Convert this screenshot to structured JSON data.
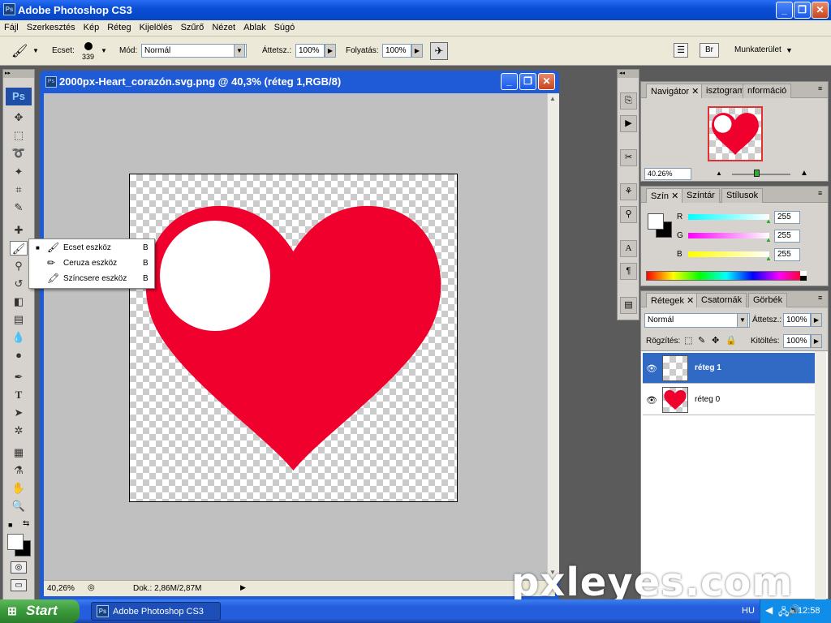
{
  "app": {
    "title": "Adobe Photoshop CS3",
    "icon_text": "Ps"
  },
  "menu": [
    "Fájl",
    "Szerkesztés",
    "Kép",
    "Réteg",
    "Kijelölés",
    "Szűrő",
    "Nézet",
    "Ablak",
    "Súgó"
  ],
  "options": {
    "brush_label": "Ecset:",
    "brush_size": "339",
    "mode_label": "Mód:",
    "mode_value": "Normál",
    "opacity_label": "Áttetsz.:",
    "opacity_value": "100%",
    "flow_label": "Folyatás:",
    "flow_value": "100%",
    "workspace_label": "Munkaterület"
  },
  "document": {
    "title": "2000px-Heart_corazón.svg.png @ 40,3% (réteg 1,RGB/8)",
    "zoom": "40,26%",
    "doc_info": "Dok.: 2,86M/2,87M",
    "colors": {
      "heart": "#f0002d",
      "circle": "#ffffff"
    }
  },
  "flyout": [
    {
      "label": "Ecset eszköz",
      "key": "B",
      "icon": "brush-icon",
      "selected": true
    },
    {
      "label": "Ceruza eszköz",
      "key": "B",
      "icon": "pencil-icon",
      "selected": false
    },
    {
      "label": "Színcsere eszköz",
      "key": "B",
      "icon": "color-replace-icon",
      "selected": false
    }
  ],
  "navigator": {
    "tabs": [
      "Navigátor",
      "isztogram",
      "nformáció"
    ],
    "zoom_value": "40.26%"
  },
  "color_panel": {
    "tabs": [
      "Szín",
      "Színtár",
      "Stílusok"
    ],
    "r_label": "R",
    "r_value": "255",
    "g_label": "G",
    "g_value": "255",
    "b_label": "B",
    "b_value": "255"
  },
  "layers_panel": {
    "tabs": [
      "Rétegek",
      "Csatornák",
      "Görbék"
    ],
    "blend_mode": "Normál",
    "opacity_label": "Áttetsz.:",
    "opacity_value": "100%",
    "lock_label": "Rögzítés:",
    "fill_label": "Kitöltés:",
    "fill_value": "100%",
    "layers": [
      {
        "name": "réteg 1",
        "selected": true
      },
      {
        "name": "réteg 0",
        "selected": false
      }
    ]
  },
  "taskbar": {
    "start_label": "Start",
    "task_label": "Adobe Photoshop CS3",
    "lang": "HU",
    "time": "12:58"
  },
  "watermark": "pxleyes.com"
}
